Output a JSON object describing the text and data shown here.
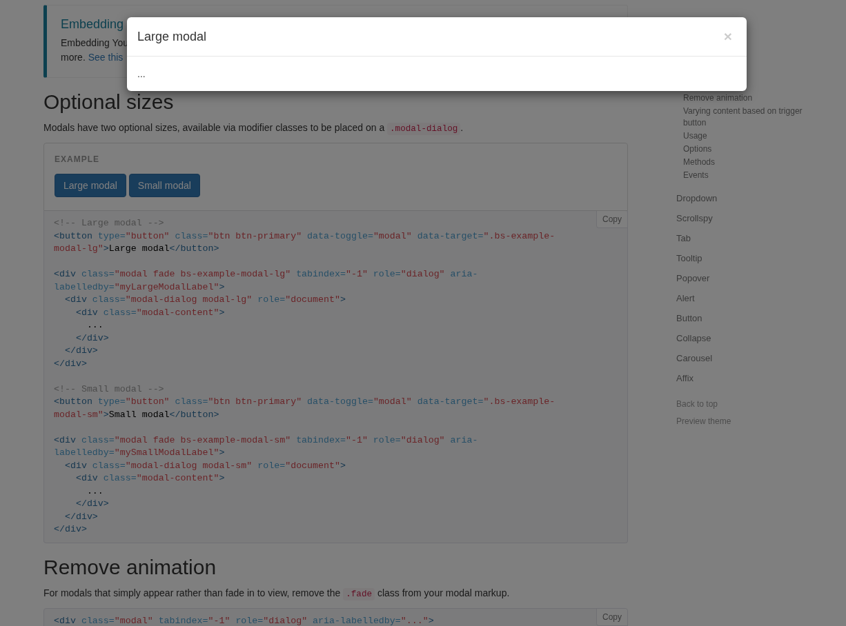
{
  "callout": {
    "title": "Embedding",
    "text": "Embedding You",
    "text_2": "more.",
    "link": "See this"
  },
  "sections": [
    {
      "heading": "Optional sizes",
      "intro": "Modals have two optional sizes, available via modifier classes to be placed on a",
      "intro_code": ".modal-dialog",
      "intro_after": ".",
      "example": {
        "label": "EXAMPLE",
        "buttons": [
          "Large modal",
          "Small modal"
        ]
      },
      "copy": "Copy",
      "code": [
        [
          [
            {
              "kind": "comment",
              "text": "<!-- Large modal -->"
            }
          ],
          [
            {
              "kind": "tag",
              "text": "<button "
            },
            {
              "kind": "attr",
              "text": "type="
            },
            {
              "kind": "string",
              "text": "\"button\" "
            },
            {
              "kind": "attr",
              "text": "class="
            },
            {
              "kind": "string",
              "text": "\"btn btn-primary\" "
            },
            {
              "kind": "attr",
              "text": "data-toggle="
            },
            {
              "kind": "string",
              "text": "\"modal\" "
            },
            {
              "kind": "attr",
              "text": "data-target="
            },
            {
              "kind": "string",
              "text": "\".bs-example-"
            }
          ],
          [
            {
              "kind": "string",
              "text": "modal-lg\""
            },
            {
              "kind": "tag",
              "text": ">"
            },
            {
              "kind": "text",
              "text": "Large modal"
            },
            {
              "kind": "tag",
              "text": "</button>"
            }
          ]
        ],
        [
          [
            {
              "kind": "tag",
              "text": "<div "
            },
            {
              "kind": "attr",
              "text": "class="
            },
            {
              "kind": "string",
              "text": "\"modal fade bs-example-modal-lg\" "
            },
            {
              "kind": "attr",
              "text": "tabindex="
            },
            {
              "kind": "string",
              "text": "\"-1\" "
            },
            {
              "kind": "attr",
              "text": "role="
            },
            {
              "kind": "string",
              "text": "\"dialog\" "
            },
            {
              "kind": "attr",
              "text": "aria-"
            }
          ],
          [
            {
              "kind": "attr",
              "text": "labelledby="
            },
            {
              "kind": "string",
              "text": "\"myLargeModalLabel\""
            },
            {
              "kind": "tag",
              "text": ">"
            }
          ],
          [
            {
              "kind": "tag",
              "text": "  <div "
            },
            {
              "kind": "attr",
              "text": "class="
            },
            {
              "kind": "string",
              "text": "\"modal-dialog modal-lg\" "
            },
            {
              "kind": "attr",
              "text": "role="
            },
            {
              "kind": "string",
              "text": "\"document\""
            },
            {
              "kind": "tag",
              "text": ">"
            }
          ],
          [
            {
              "kind": "tag",
              "text": "    <div "
            },
            {
              "kind": "attr",
              "text": "class="
            },
            {
              "kind": "string",
              "text": "\"modal-content\""
            },
            {
              "kind": "tag",
              "text": ">"
            }
          ],
          [
            {
              "kind": "text",
              "text": "      ..."
            }
          ],
          [
            {
              "kind": "tag",
              "text": "    </div>"
            }
          ],
          [
            {
              "kind": "tag",
              "text": "  </div>"
            }
          ],
          [
            {
              "kind": "tag",
              "text": "</div>"
            }
          ]
        ],
        [
          [
            {
              "kind": "comment",
              "text": "<!-- Small modal -->"
            }
          ],
          [
            {
              "kind": "tag",
              "text": "<button "
            },
            {
              "kind": "attr",
              "text": "type="
            },
            {
              "kind": "string",
              "text": "\"button\" "
            },
            {
              "kind": "attr",
              "text": "class="
            },
            {
              "kind": "string",
              "text": "\"btn btn-primary\" "
            },
            {
              "kind": "attr",
              "text": "data-toggle="
            },
            {
              "kind": "string",
              "text": "\"modal\" "
            },
            {
              "kind": "attr",
              "text": "data-target="
            },
            {
              "kind": "string",
              "text": "\".bs-example-"
            }
          ],
          [
            {
              "kind": "string",
              "text": "modal-sm\""
            },
            {
              "kind": "tag",
              "text": ">"
            },
            {
              "kind": "text",
              "text": "Small modal"
            },
            {
              "kind": "tag",
              "text": "</button>"
            }
          ]
        ],
        [
          [
            {
              "kind": "tag",
              "text": "<div "
            },
            {
              "kind": "attr",
              "text": "class="
            },
            {
              "kind": "string",
              "text": "\"modal fade bs-example-modal-sm\" "
            },
            {
              "kind": "attr",
              "text": "tabindex="
            },
            {
              "kind": "string",
              "text": "\"-1\" "
            },
            {
              "kind": "attr",
              "text": "role="
            },
            {
              "kind": "string",
              "text": "\"dialog\" "
            },
            {
              "kind": "attr",
              "text": "aria-"
            }
          ],
          [
            {
              "kind": "attr",
              "text": "labelledby="
            },
            {
              "kind": "string",
              "text": "\"mySmallModalLabel\""
            },
            {
              "kind": "tag",
              "text": ">"
            }
          ],
          [
            {
              "kind": "tag",
              "text": "  <div "
            },
            {
              "kind": "attr",
              "text": "class="
            },
            {
              "kind": "string",
              "text": "\"modal-dialog modal-sm\" "
            },
            {
              "kind": "attr",
              "text": "role="
            },
            {
              "kind": "string",
              "text": "\"document\""
            },
            {
              "kind": "tag",
              "text": ">"
            }
          ],
          [
            {
              "kind": "tag",
              "text": "    <div "
            },
            {
              "kind": "attr",
              "text": "class="
            },
            {
              "kind": "string",
              "text": "\"modal-content\""
            },
            {
              "kind": "tag",
              "text": ">"
            }
          ],
          [
            {
              "kind": "text",
              "text": "      ..."
            }
          ],
          [
            {
              "kind": "tag",
              "text": "    </div>"
            }
          ],
          [
            {
              "kind": "tag",
              "text": "  </div>"
            }
          ],
          [
            {
              "kind": "tag",
              "text": "</div>"
            }
          ]
        ]
      ]
    },
    {
      "heading": "Remove animation",
      "intro": "For modals that simply appear rather than fade in to view, remove the",
      "intro_code": ".fade",
      "intro_after": "class from your modal markup.",
      "copy": "Copy",
      "code": [
        [
          [
            {
              "kind": "tag",
              "text": "<div "
            },
            {
              "kind": "attr",
              "text": "class="
            },
            {
              "kind": "string",
              "text": "\"modal\" "
            },
            {
              "kind": "attr",
              "text": "tabindex="
            },
            {
              "kind": "string",
              "text": "\"-1\" "
            },
            {
              "kind": "attr",
              "text": "role="
            },
            {
              "kind": "string",
              "text": "\"dialog\" "
            },
            {
              "kind": "attr",
              "text": "aria-labelledby="
            },
            {
              "kind": "string",
              "text": "\"...\""
            },
            {
              "kind": "tag",
              "text": ">"
            }
          ]
        ]
      ]
    }
  ],
  "sidebar": {
    "items": [
      {
        "label": "Remove animation",
        "sub": true
      },
      {
        "label": "Varying content based on trigger button",
        "sub": true
      },
      {
        "label": "Usage",
        "sub": true
      },
      {
        "label": "Options",
        "sub": true
      },
      {
        "label": "Methods",
        "sub": true
      },
      {
        "label": "Events",
        "sub": true
      },
      {
        "label": "Dropdown",
        "sub": false
      },
      {
        "label": "Scrollspy",
        "sub": false
      },
      {
        "label": "Tab",
        "sub": false
      },
      {
        "label": "Tooltip",
        "sub": false
      },
      {
        "label": "Popover",
        "sub": false
      },
      {
        "label": "Alert",
        "sub": false
      },
      {
        "label": "Button",
        "sub": false
      },
      {
        "label": "Collapse",
        "sub": false
      },
      {
        "label": "Carousel",
        "sub": false
      },
      {
        "label": "Affix",
        "sub": false
      }
    ],
    "footer_links": [
      "Back to top",
      "Preview theme"
    ]
  },
  "modal": {
    "title": "Large modal",
    "close": "×",
    "body": "..."
  }
}
